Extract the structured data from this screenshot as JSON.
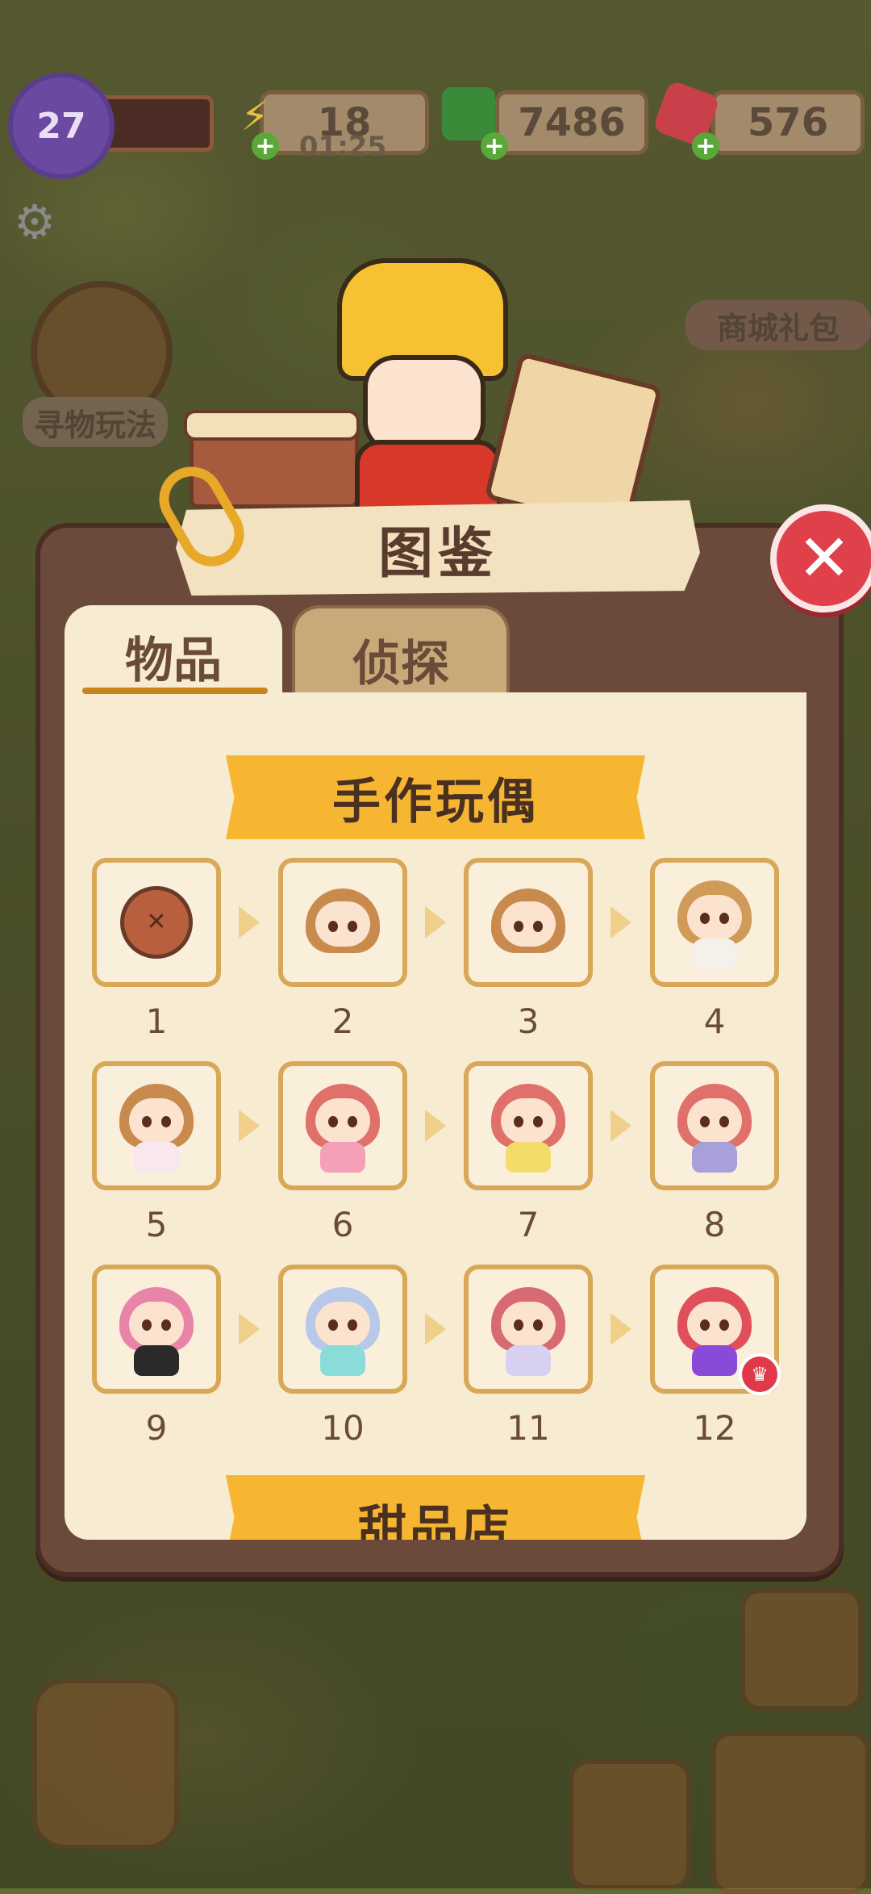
{
  "hud": {
    "level": "27",
    "energy": "18",
    "energy_timer": "01:25",
    "cash": "7486",
    "gems": "576"
  },
  "side": {
    "find_mode": "寻物玩法",
    "shop_pack": "商城礼包"
  },
  "panel": {
    "title": "图鉴",
    "tabs": [
      {
        "label": "物品",
        "active": true
      },
      {
        "label": "侦探",
        "active": false
      }
    ],
    "section_title": "手作玩偶",
    "next_section_title": "甜品店",
    "items": [
      {
        "num": "1",
        "kind": "button"
      },
      {
        "num": "2",
        "kind": "head",
        "hair": "#c98a4e"
      },
      {
        "num": "3",
        "kind": "head",
        "hair": "#c98a4e"
      },
      {
        "num": "4",
        "kind": "doll",
        "hair": "#d09a58",
        "dress": "#f6f0ea"
      },
      {
        "num": "5",
        "kind": "doll",
        "hair": "#c98a4e",
        "dress": "#f8e8ee"
      },
      {
        "num": "6",
        "kind": "doll",
        "hair": "#e0706a",
        "dress": "#f4a0b8"
      },
      {
        "num": "7",
        "kind": "doll",
        "hair": "#e0706a",
        "dress": "#f4dc6a"
      },
      {
        "num": "8",
        "kind": "doll",
        "hair": "#e0706a",
        "dress": "#a8a0d8"
      },
      {
        "num": "9",
        "kind": "doll",
        "hair": "#e884a8",
        "dress": "#2a2a2a"
      },
      {
        "num": "10",
        "kind": "doll",
        "hair": "#b8c8e8",
        "dress": "#8adcd8"
      },
      {
        "num": "11",
        "kind": "doll",
        "hair": "#d86a74",
        "dress": "#d8d0f0"
      },
      {
        "num": "12",
        "kind": "doll",
        "hair": "#e0505a",
        "dress": "#8a4ad8",
        "crowned": true
      }
    ]
  },
  "colors": {
    "panel_bg": "#6b4a3c",
    "content_bg": "#f7ecd2",
    "banner": "#f6b632",
    "close": "#e0404a"
  },
  "icons": {
    "close": "close-icon",
    "settings": "gear-icon",
    "energy": "lightning-icon",
    "cash": "cash-icon",
    "gems": "gem-icon"
  }
}
